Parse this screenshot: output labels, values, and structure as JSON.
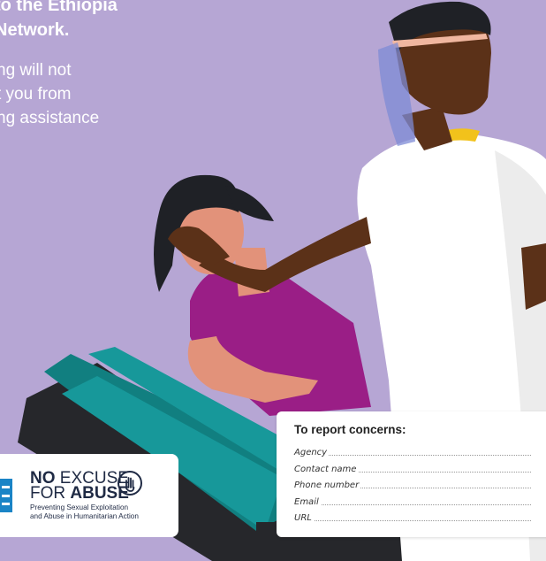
{
  "headline": {
    "line1": "to the Ethiopia",
    "line2": "Network."
  },
  "subtext": {
    "line1": "ng will not",
    "line2": "t you from",
    "line3": "ng assistance"
  },
  "report": {
    "title": "To report concerns:",
    "fields": [
      "Agency",
      "Contact name",
      "Phone number",
      "Email",
      "URL"
    ]
  },
  "badge": {
    "line1_bold": "NO",
    "line1_rest": " EXCUSE",
    "line2_rest": "FOR ",
    "line2_bold": "ABUSE",
    "sub1": "Preventing Sexual Exploitation",
    "sub2": "and Abuse in Humanitarian Action"
  },
  "colors": {
    "background": "#b6a6d4",
    "chair": "#17989a",
    "patient_shirt": "#9a1e86",
    "skin_patient": "#e2927a",
    "skin_provider": "#5b3118",
    "coat": "#ffffff",
    "badge_blue": "#1a84c6"
  },
  "icons": {
    "badge_logo": "un-emblem-icon",
    "hand": "stop-hand-icon"
  }
}
